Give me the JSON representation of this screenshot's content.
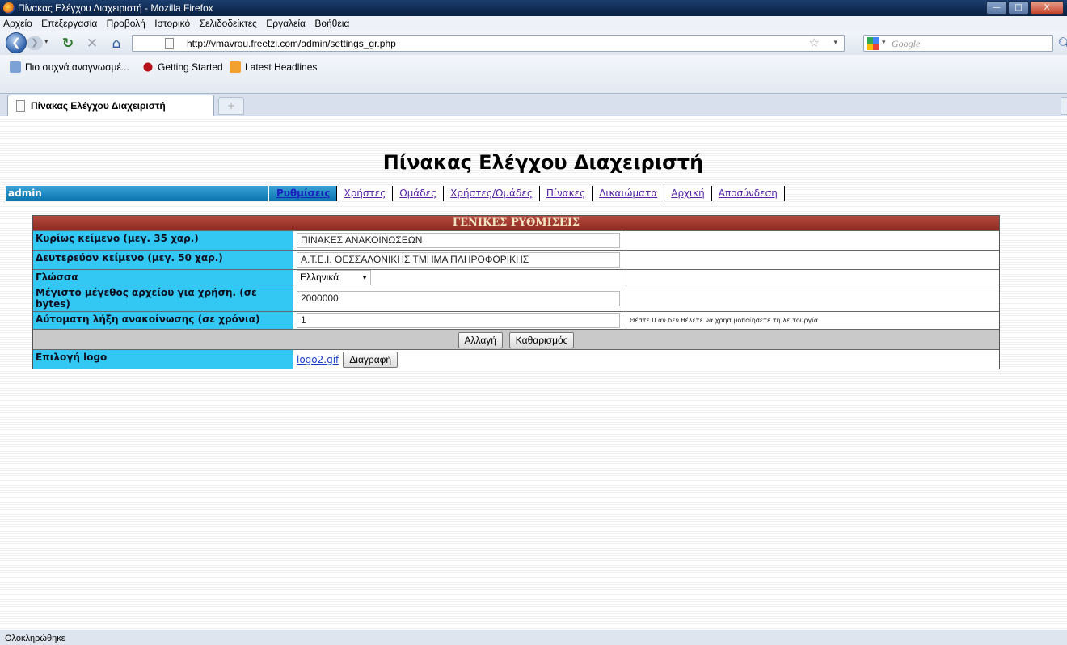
{
  "window": {
    "title": "Πίνακας Ελέγχου Διαχειριστή - Mozilla Firefox",
    "buttons": {
      "minimize": "—",
      "maximize": "□",
      "close": "X"
    }
  },
  "menu": [
    "Αρχείο",
    "Επεξεργασία",
    "Προβολή",
    "Ιστορικό",
    "Σελιδοδείκτες",
    "Εργαλεία",
    "Βοήθεια"
  ],
  "nav": {
    "back_icon": "back-arrow-icon",
    "url": "http://vmavrou.freetzi.com/admin/settings_gr.php",
    "search_placeholder": "Google"
  },
  "bookmarks": [
    "Πιο συχνά αναγνωσμέ...",
    "Getting Started",
    "Latest Headlines"
  ],
  "tab": {
    "label": "Πίνακας Ελέγχου Διαχειριστή",
    "new_tab": "+"
  },
  "page": {
    "title": "Πίνακας Ελέγχου Διαχειριστή",
    "user": "admin",
    "links": [
      {
        "label": "Ρυθμίσεις",
        "active": true
      },
      {
        "label": "Χρήστες"
      },
      {
        "label": "Ομάδες"
      },
      {
        "label": "Χρήστες/Ομάδες"
      },
      {
        "label": "Πίνακες"
      },
      {
        "label": "Δικαιώματα"
      },
      {
        "label": "Αρχική"
      },
      {
        "label": "Αποσύνδεση"
      }
    ],
    "settings": {
      "header": "ΓΕΝΙΚΕΣ ΡΥΘΜΙΣΕΙΣ",
      "main_text_label": "Κυρίως κείμενο (μεγ. 35 χαρ.)",
      "main_text_value": "ΠΙΝΑΚΕΣ ΑΝΑΚΟΙΝΩΣΕΩΝ",
      "sub_text_label": "Δευτερεύον κείμενο (μεγ. 50 χαρ.)",
      "sub_text_value": "Α.Τ.Ε.Ι. ΘΕΣΣΑΛΟΝΙΚΗΣ ΤΜΗΜΑ ΠΛΗΡΟΦΟΡΙΚΗΣ",
      "language_label": "Γλώσσα",
      "language_value": "Ελληνικά",
      "max_size_label": "Μέγιστο μέγεθος αρχείου για χρήση. (σε bytes)",
      "max_size_value": "2000000",
      "expiry_label": "Αύτοματη λήξη ανακοίνωσης (σε χρόνια)",
      "expiry_value": "1",
      "expiry_note": "Θέστε 0 αν δεν θέλετε να χρησιμοποίησετε τη λειτουργία",
      "change_button": "Αλλαγή",
      "clear_button": "Καθαρισμός",
      "logo_label": "Επιλογή logo",
      "logo_file": "logo2.gif",
      "delete_button": "Διαγραφή"
    }
  },
  "status": "Ολοκληρώθηκε"
}
